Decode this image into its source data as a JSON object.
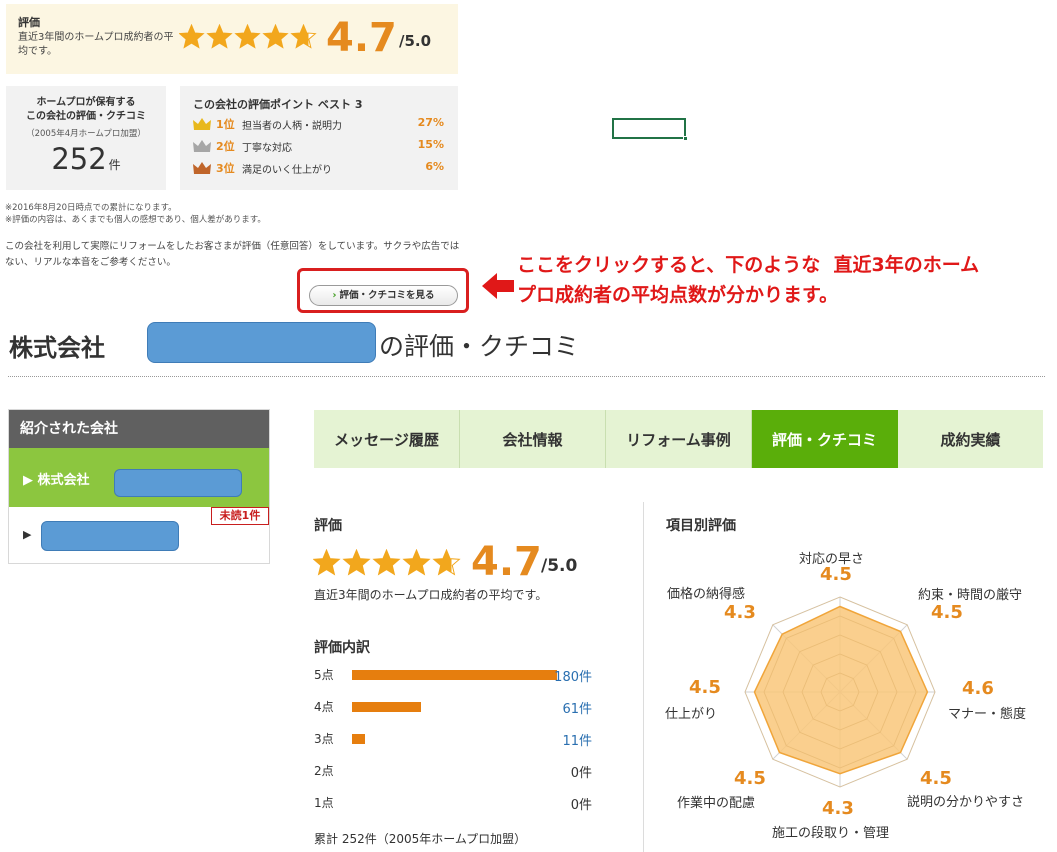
{
  "summary": {
    "label": "評価",
    "desc": "直近3年間のホームプロ成約者の平均です。",
    "score": "4.7",
    "max": "/5.0",
    "stars_value": 4.7
  },
  "count_box": {
    "title_line1": "ホームプロが保有する",
    "title_line2": "この会社の評価・クチコミ",
    "sub": "（2005年4月ホームプロ加盟）",
    "count": "252",
    "unit": "件"
  },
  "best_points": {
    "title": "この会社の評価ポイント ベスト 3",
    "items": [
      {
        "rank": "1位",
        "item": "担当者の人柄・説明力",
        "pct": "27%",
        "crown_color": "#e8b81c"
      },
      {
        "rank": "2位",
        "item": "丁寧な対応",
        "pct": "15%",
        "crown_color": "#a6a6a6"
      },
      {
        "rank": "3位",
        "item": "満足のいく仕上がり",
        "pct": "6%",
        "crown_color": "#c0652a"
      }
    ]
  },
  "notes": {
    "line1": "※2016年8月20日時点での累計になります。",
    "line2": "※評価の内容は、あくまでも個人の感想であり、個人差があります。",
    "usage": "この会社を利用して実際にリフォームをしたお客さまが評価（任意回答）をしています。サクラや広告ではない、リアルな本音をご参考ください。"
  },
  "view_button": {
    "chevron": "›",
    "label": "評価・クチコミを見る"
  },
  "annotation": {
    "line1": "ここをクリックすると、下のような  直近3年のホーム",
    "line2": "プロ成約者の平均点数が分かります。"
  },
  "page_title": {
    "prefix": "株式会社",
    "suffix": "の評価・クチコミ"
  },
  "sidebar": {
    "heading": "紹介された会社",
    "item1_label": "▶ 株式会社",
    "item2_arrow": "▶",
    "unread_badge": "未読1件"
  },
  "tabs": [
    {
      "label": "メッセージ履歴",
      "active": false
    },
    {
      "label": "会社情報",
      "active": false
    },
    {
      "label": "リフォーム事例",
      "active": false
    },
    {
      "label": "評価・クチコミ",
      "active": true
    },
    {
      "label": "成約実績",
      "active": false
    }
  ],
  "rating": {
    "heading": "評価",
    "score": "4.7",
    "max": "/5.0",
    "stars_value": 4.7,
    "desc": "直近3年間のホームプロ成約者の平均です。"
  },
  "breakdown": {
    "heading": "評価内訳",
    "total": 252,
    "rows": [
      {
        "label": "5点",
        "count": 180,
        "count_text": "180件",
        "linked": true
      },
      {
        "label": "4点",
        "count": 61,
        "count_text": "61件",
        "linked": true
      },
      {
        "label": "3点",
        "count": 11,
        "count_text": "11件",
        "linked": true
      },
      {
        "label": "2点",
        "count": 0,
        "count_text": "0件",
        "linked": false
      },
      {
        "label": "1点",
        "count": 0,
        "count_text": "0件",
        "linked": false
      }
    ],
    "cumulative": "累計 252件（2005年ホームプロ加盟）"
  },
  "radar": {
    "heading": "項目別評価",
    "max": 5,
    "axes": [
      {
        "label": "対応の早さ",
        "value": 4.5,
        "value_text": "4.5"
      },
      {
        "label": "約束・時間の厳守",
        "value": 4.5,
        "value_text": "4.5"
      },
      {
        "label": "マナー・態度",
        "value": 4.6,
        "value_text": "4.6"
      },
      {
        "label": "説明の分かりやすさ",
        "value": 4.5,
        "value_text": "4.5"
      },
      {
        "label": "施工の段取り・管理",
        "value": 4.3,
        "value_text": "4.3"
      },
      {
        "label": "作業中の配慮",
        "value": 4.5,
        "value_text": "4.5"
      },
      {
        "label": "仕上がり",
        "value": 4.5,
        "value_text": "4.5"
      },
      {
        "label": "価格の納得感",
        "value": 4.3,
        "value_text": "4.3"
      }
    ],
    "fill_color": "#f9c77a",
    "stroke_color": "#f0a53a"
  },
  "colors": {
    "accent_orange": "#e58a1f",
    "tab_active": "#5aae0a",
    "tab_inactive": "#e5f3d3",
    "sidebar_active": "#8cc63f",
    "link_blue": "#2a6fb0",
    "annotation_red": "#e01818"
  }
}
